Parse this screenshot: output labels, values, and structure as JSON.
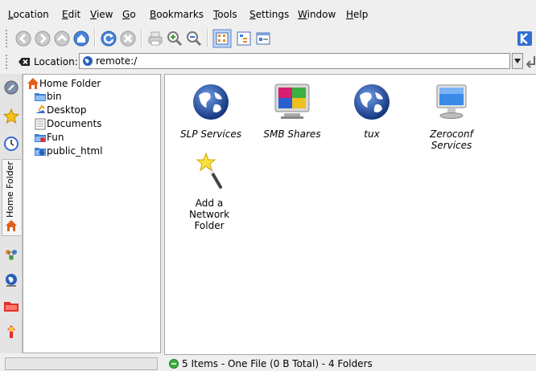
{
  "menu": [
    "Location",
    "Edit",
    "View",
    "Go",
    "Bookmarks",
    "Tools",
    "Settings",
    "Window",
    "Help"
  ],
  "menu_mnemonic": [
    "L",
    "E",
    "V",
    "G",
    "B",
    "T",
    "S",
    "W",
    "H"
  ],
  "toolbar": {
    "buttons": [
      "back-icon",
      "forward-icon",
      "up-icon",
      "home-icon",
      "reload-icon",
      "stop-icon",
      "print-icon",
      "zoom-in-icon",
      "zoom-out-icon",
      "icon-view-icon",
      "tree-view-icon",
      "detail-view-icon",
      "konqueror-logo-icon"
    ]
  },
  "location": {
    "label": "Location:",
    "value": "remote:/"
  },
  "sidebar": {
    "active_tab": "Home Folder"
  },
  "tree": {
    "root": "Home Folder",
    "children": [
      "bin",
      "Desktop",
      "Documents",
      "Fun",
      "public_html"
    ]
  },
  "items": [
    {
      "line1": "SLP Services",
      "line2": "",
      "icon": "globe-icon"
    },
    {
      "line1": "SMB Shares",
      "line2": "",
      "icon": "smb-shares-icon"
    },
    {
      "line1": "tux",
      "line2": "",
      "icon": "globe-icon"
    },
    {
      "line1": "Zeroconf",
      "line2": "Services",
      "icon": "monitor-icon"
    },
    {
      "line1": "Add a",
      "line2": "Network Folder",
      "icon": "magic-wand-icon"
    }
  ],
  "status": "5 Items - One File (0 B Total) - 4 Folders",
  "colors": {
    "folder_blue": "#3a7fd8",
    "home_orange": "#e0601a",
    "status_green": "#3cb040"
  }
}
